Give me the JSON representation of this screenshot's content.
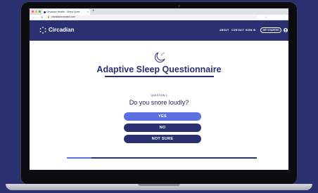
{
  "browser": {
    "tab_title": "Circadian Health - Sleep Ques",
    "tab_close": "×",
    "new_tab": "+",
    "url": "circadianconnect.com"
  },
  "site": {
    "brand": "Circadian",
    "nav": [
      {
        "label": "ABOUT"
      },
      {
        "label": "CONTACT"
      },
      {
        "label": "SIGN IN"
      }
    ],
    "cta_label": "GET STARTED"
  },
  "main": {
    "title": "Adaptive Sleep Questionnaire",
    "question_number": "QUESTION 1",
    "question": "Do you snore loudly?",
    "answers": [
      {
        "label": "YES",
        "selected": true
      },
      {
        "label": "NO",
        "selected": false
      },
      {
        "label": "NOT SURE",
        "selected": false
      }
    ],
    "progress": 0.13
  },
  "colors": {
    "brand_navy": "#2b3170",
    "selected_blue": "#5b6fe0",
    "background": "#ffffff"
  }
}
